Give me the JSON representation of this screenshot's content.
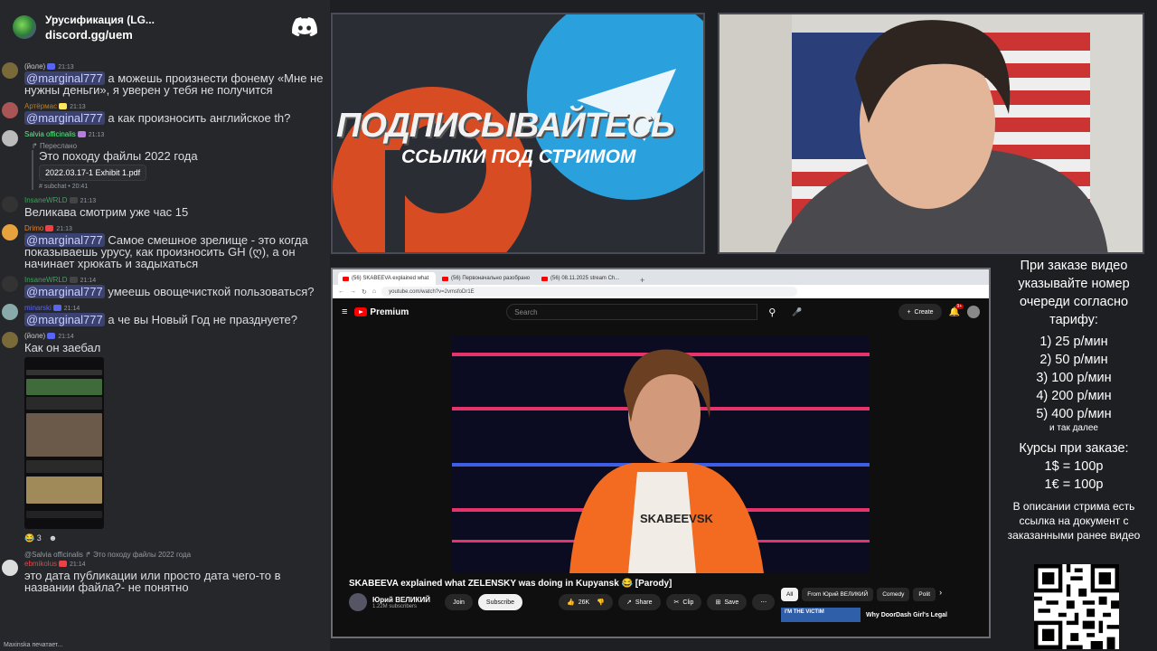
{
  "server": {
    "name": "Урусификация (LG...",
    "invite": "discord.gg/uem"
  },
  "messages": [
    {
      "author": "(йоле)",
      "author_color": "#c9c9c9",
      "time": "21:13",
      "mention": "@marginal777",
      "text": " а можешь произнести фонему «Мне не нужны деньги», я уверен у тебя не получится"
    },
    {
      "author": "Артёрмас",
      "author_color": "#c27c0e",
      "time": "21:13",
      "mention": "@marginal777",
      "text": " а как произносить английское th?"
    },
    {
      "author": "Salvia officinalis",
      "author_color": "#57f287",
      "time": "21:13",
      "forwarded_label": "Переслано",
      "text": "Это походу файлы 2022 года",
      "file": "2022.03.17-1 Exhibit 1.pdf",
      "source": "# subchat • 20:41"
    },
    {
      "author": "InsaneWRLD",
      "author_color": "#3ba55c",
      "time": "21:13",
      "text": "Великава смотрим уже час 15"
    },
    {
      "author": "Drimo",
      "author_color": "#e67e22",
      "time": "21:13",
      "mention": "@marginal777",
      "text": " Самое смешное зрелище - это когда показываешь урусу, как произносить GH (ღ), а он начинает хрюкать и задыхаться"
    },
    {
      "author": "InsaneWRLD",
      "author_color": "#3ba55c",
      "time": "21:14",
      "mention": "@marginal777",
      "text": " умеешь овощечисткой пользоваться?"
    },
    {
      "author": "minarski",
      "author_color": "#5865f2",
      "time": "21:14",
      "mention": "@marginal777",
      "text": " а че вы Новый Год не празднуете?"
    },
    {
      "author": "(йоле)",
      "author_color": "#c9c9c9",
      "time": "21:14",
      "text": "Как он заебал",
      "reactions": [
        "😂 3",
        "☻"
      ]
    },
    {
      "reply_to": "@Salvia officinalis ↱ Это походу файлы 2022 года",
      "author": "ebmikolus",
      "author_color": "#ed4245",
      "time": "21:14",
      "text": "это дата публикации или просто дата чего-то в названии файла?- не понятно"
    }
  ],
  "typing": "Maxinska печатает...",
  "poster": {
    "title": "ПОДПИСЫВАЙТЕСЬ",
    "subtitle": "ССЫЛКИ ПОД СТРИМОМ"
  },
  "browser": {
    "tabs": [
      "(56) SKABEEVA explained what",
      "(56) Первоначально разобрано",
      "(56) 08.11.2025 stream Ch..."
    ],
    "url": "youtube.com/watch?v=2vmsfoDr1E",
    "brand": "Premium",
    "search_placeholder": "Search",
    "create_label": "Create",
    "notif_count": "9+",
    "video_title": "SKABEEVA explained what ZELENSKY was doing in Kupyansk 😂 [Parody]",
    "channel": "Юрий ВЕЛИКИЙ",
    "subscribers": "1.22M subscribers",
    "join": "Join",
    "subscribe": "Subscribe",
    "likes": "26K",
    "share": "Share",
    "clip": "Clip",
    "save": "Save",
    "shirt_text": "SKABEEVSK",
    "chips": [
      "All",
      "From Юрий ВЕЛИКИЙ",
      "Comedy",
      "Polit"
    ],
    "rec_title": "Why DoorDash Girl's Legal",
    "rec_thumb": "I'M THE VICTIM"
  },
  "info": {
    "intro": "При заказе видео указывайте номер очереди согласно тарифу:",
    "tariffs": [
      "1) 25 р/мин",
      "2) 50 р/мин",
      "3) 100 р/мин",
      "4) 200 р/мин",
      "5) 400 р/мин"
    ],
    "etc": "и так далее",
    "rates_title": "Курсы при заказе:",
    "rates": [
      "1$ = 100р",
      "1€ = 100р"
    ],
    "footer": "В описании стрима есть ссылка на документ с заказанными ранее видео"
  },
  "colors": {
    "accent": "#5865f2",
    "youtube_red": "#ff0000",
    "mention_bg": "#3c4270"
  }
}
